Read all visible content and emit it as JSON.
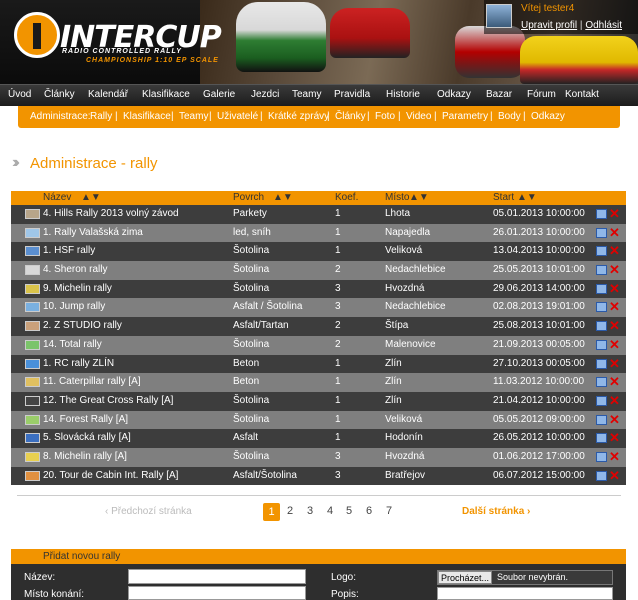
{
  "brand": {
    "name": "INTERCUP",
    "tagline1": "RADIO CONTROLLED RALLY",
    "tagline2": "CHAMPIONSHIP 1:10 EP SCALE"
  },
  "user": {
    "greeting": "Vítej tester4",
    "edit_profile": "Upravit profil",
    "separator": "|",
    "logout": "Odhlásit"
  },
  "main_nav": [
    "Úvod",
    "Články",
    "Kalendář",
    "Klasifikace",
    "Galerie",
    "Jezdci",
    "Teamy",
    "Pravidla",
    "Historie",
    "Odkazy",
    "Bazar",
    "Fórum",
    "Kontakt"
  ],
  "admin_nav": {
    "label": "Administrace:",
    "items": [
      "Rally",
      "Klasifikace",
      "Teamy",
      "Uživatelé",
      "Krátké zprávy",
      "Články",
      "Foto",
      "Video",
      "Parametry",
      "Body",
      "Odkazy"
    ]
  },
  "page": {
    "title": "Administrace - rally"
  },
  "table": {
    "columns": {
      "name": "Název",
      "surface": "Povrch",
      "coef": "Koef.",
      "place": "Místo",
      "start": "Start"
    },
    "rows": [
      {
        "name": "4. Hills Rally 2013 volný závod",
        "surface": "Parkety",
        "coef": "1",
        "place": "Lhota",
        "start": "05.01.2013 10:00:00",
        "flag": "#b7a58a"
      },
      {
        "name": "1. Rally Valašská zima",
        "surface": "led, sníh",
        "coef": "1",
        "place": "Napajedla",
        "start": "26.01.2013 10:00:00",
        "flag": "#9fc6e8"
      },
      {
        "name": "1. HSF rally",
        "surface": "Šotolina",
        "coef": "1",
        "place": "Veliková",
        "start": "13.04.2013 10:00:00",
        "flag": "#5b8fd0"
      },
      {
        "name": "4. Sheron rally",
        "surface": "Šotolina",
        "coef": "2",
        "place": "Nedachlebice",
        "start": "25.05.2013 10:01:00",
        "flag": "#d8d8d8"
      },
      {
        "name": "9. Michelin rally",
        "surface": "Šotolina",
        "coef": "3",
        "place": "Hvozdná",
        "start": "29.06.2013 14:00:00",
        "flag": "#d9c34a"
      },
      {
        "name": "10. Jump rally",
        "surface": "Asfalt / Šotolina",
        "coef": "3",
        "place": "Nedachlebice",
        "start": "02.08.2013 19:01:00",
        "flag": "#7ab0e0"
      },
      {
        "name": "2. Z STUDIO rally",
        "surface": "Asfalt/Tartan",
        "coef": "2",
        "place": "Štípa",
        "start": "25.08.2013 10:01:00",
        "flag": "#c9a07a"
      },
      {
        "name": "14. Total rally",
        "surface": "Šotolina",
        "coef": "2",
        "place": "Malenovice",
        "start": "21.09.2013 00:05:00",
        "flag": "#7bc46a"
      },
      {
        "name": "1. RC rally ZLÍN",
        "surface": "Beton",
        "coef": "1",
        "place": "Zlín",
        "start": "27.10.2013 00:05:00",
        "flag": "#4a90d9"
      },
      {
        "name": "11. Caterpillar rally [A]",
        "surface": "Beton",
        "coef": "1",
        "place": "Zlín",
        "start": "11.03.2012 10:00:00",
        "flag": "#e0c060"
      },
      {
        "name": "12. The Great Cross Rally [A]",
        "surface": "Šotolina",
        "coef": "1",
        "place": "Zlín",
        "start": "21.04.2012 10:00:00",
        "flag": "#444444"
      },
      {
        "name": "14. Forest Rally [A]",
        "surface": "Šotolina",
        "coef": "1",
        "place": "Veliková",
        "start": "05.05.2012 09:00:00",
        "flag": "#9acd6a"
      },
      {
        "name": "5. Slovácká rally [A]",
        "surface": "Asfalt",
        "coef": "1",
        "place": "Hodonín",
        "start": "26.05.2012 10:00:00",
        "flag": "#3b6fc0"
      },
      {
        "name": "8. Michelin rally [A]",
        "surface": "Šotolina",
        "coef": "3",
        "place": "Hvozdná",
        "start": "01.06.2012 17:00:00",
        "flag": "#e8d050"
      },
      {
        "name": "20. Tour de Cabin Int. Rally [A]",
        "surface": "Asfalt/Šotolina",
        "coef": "3",
        "place": "Bratřejov",
        "start": "06.07.2012 15:00:00",
        "flag": "#e09040"
      }
    ]
  },
  "pagination": {
    "prev": "Předchozí stránka",
    "next": "Další stránka",
    "pages": [
      "1",
      "2",
      "3",
      "4",
      "5",
      "6",
      "7"
    ],
    "current": "1"
  },
  "add_form": {
    "title": "Přidat novou rally",
    "name_label": "Název:",
    "venue_label": "Místo konání:",
    "logo_label": "Logo:",
    "description_label": "Popis:",
    "browse_button": "Procházet...",
    "no_file": "Soubor nevybrán."
  },
  "colors": {
    "accent": "#f29400",
    "row_dark": "#3d3d3d",
    "row_light": "#7f7f7f",
    "delete": "#e00000"
  }
}
